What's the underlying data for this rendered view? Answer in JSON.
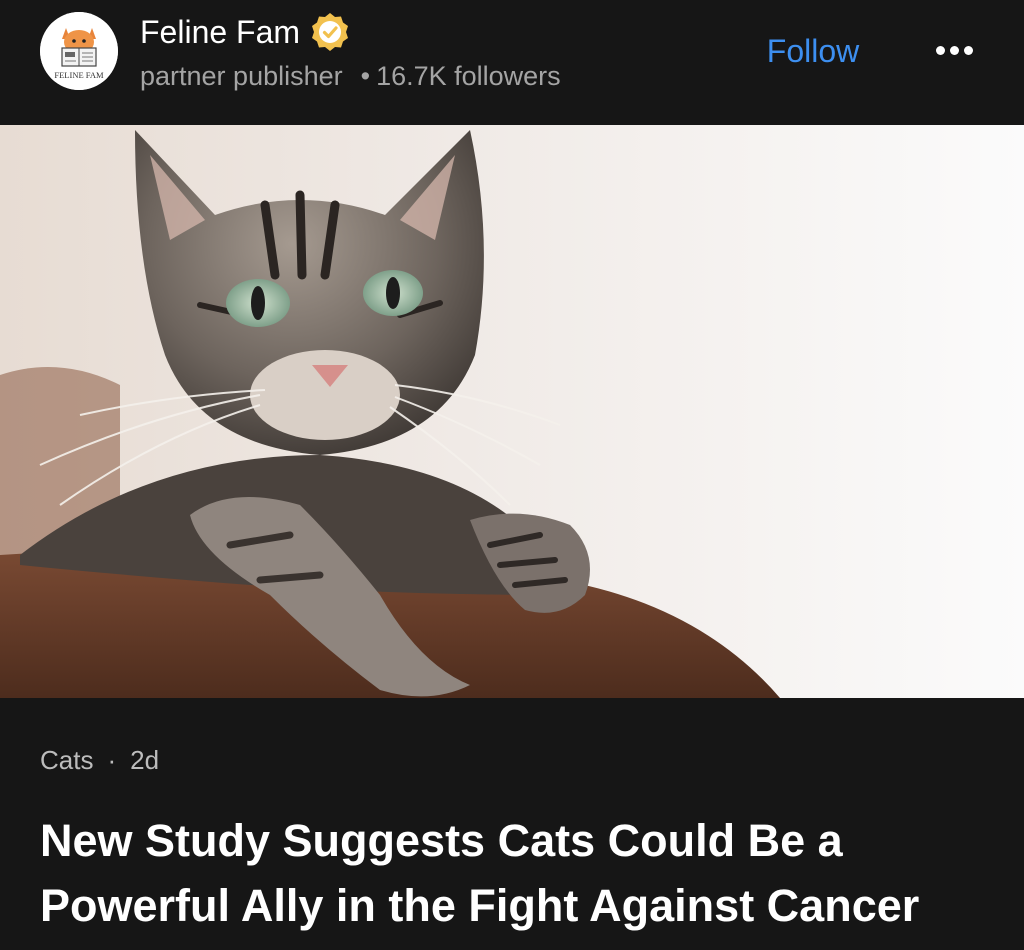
{
  "publisher": {
    "name": "Feline Fam",
    "role": "partner publisher",
    "followers": "16.7K followers",
    "logo_text": "FELINE FAM",
    "verified_icon": "verified-badge-icon",
    "verified_color": "#f2c14e"
  },
  "header": {
    "follow_label": "Follow",
    "follow_color": "#3d8ff0",
    "more_icon": "more-options-icon"
  },
  "hero_image": {
    "subject": "tabby cat resting paws on brown cushion"
  },
  "article": {
    "category": "Cats",
    "separator": "·",
    "age": "2d",
    "headline": "New Study Suggests Cats Could Be a Powerful Ally in the Fight Against Cancer"
  }
}
